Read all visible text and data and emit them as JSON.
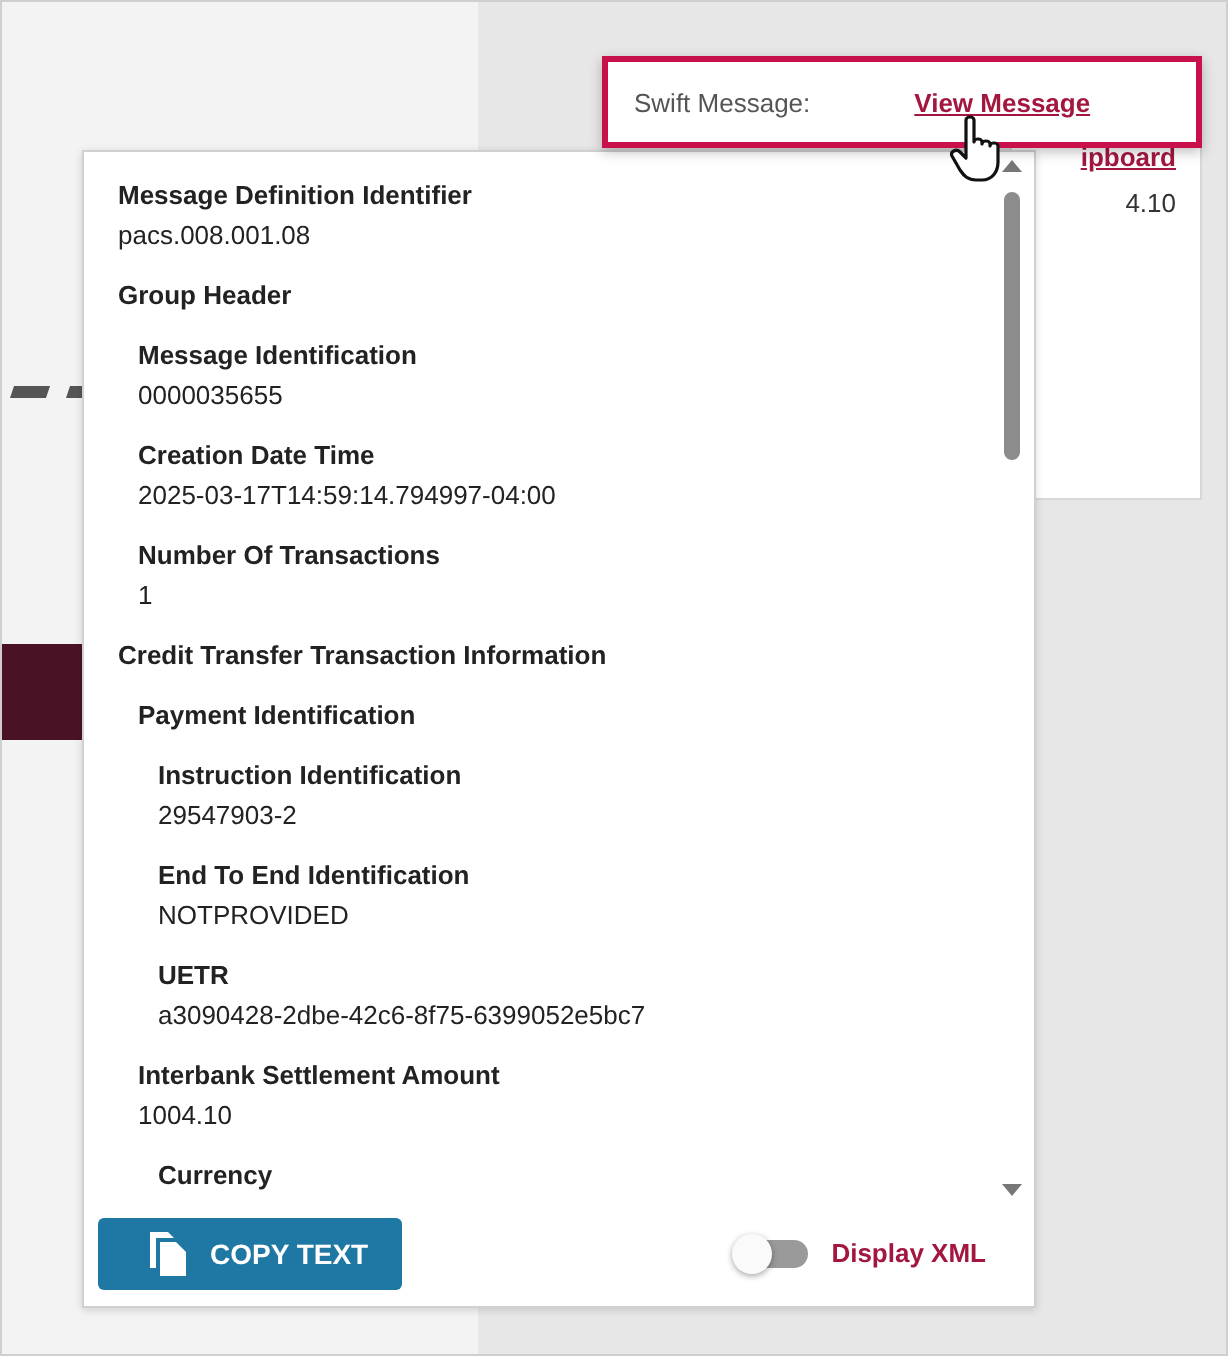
{
  "background_card": {
    "link": "ipboard",
    "value": "4.10"
  },
  "swift_popup": {
    "label": "Swift Message:",
    "link": "View Message"
  },
  "message_tree": [
    {
      "label": "Message Definition Identifier",
      "value": "pacs.008.001.08"
    },
    {
      "label": "Group Header",
      "children": [
        {
          "label": "Message Identification",
          "value": "0000035655"
        },
        {
          "label": "Creation Date Time",
          "value": "2025-03-17T14:59:14.794997-04:00"
        },
        {
          "label": "Number Of Transactions",
          "value": "1"
        }
      ]
    },
    {
      "label": "Credit Transfer Transaction Information",
      "children": [
        {
          "label": "Payment Identification",
          "children": [
            {
              "label": "Instruction Identification",
              "value": "29547903-2"
            },
            {
              "label": "End To End Identification",
              "value": "NOTPROVIDED"
            },
            {
              "label": "UETR",
              "value": "a3090428-2dbe-42c6-8f75-6399052e5bc7"
            }
          ]
        },
        {
          "label": "Interbank Settlement Amount",
          "value": "1004.10",
          "children": [
            {
              "label": "Currency"
            }
          ]
        }
      ]
    }
  ],
  "copy_button": {
    "label": "COPY TEXT"
  },
  "display_xml": {
    "label": "Display XML",
    "on": false
  }
}
